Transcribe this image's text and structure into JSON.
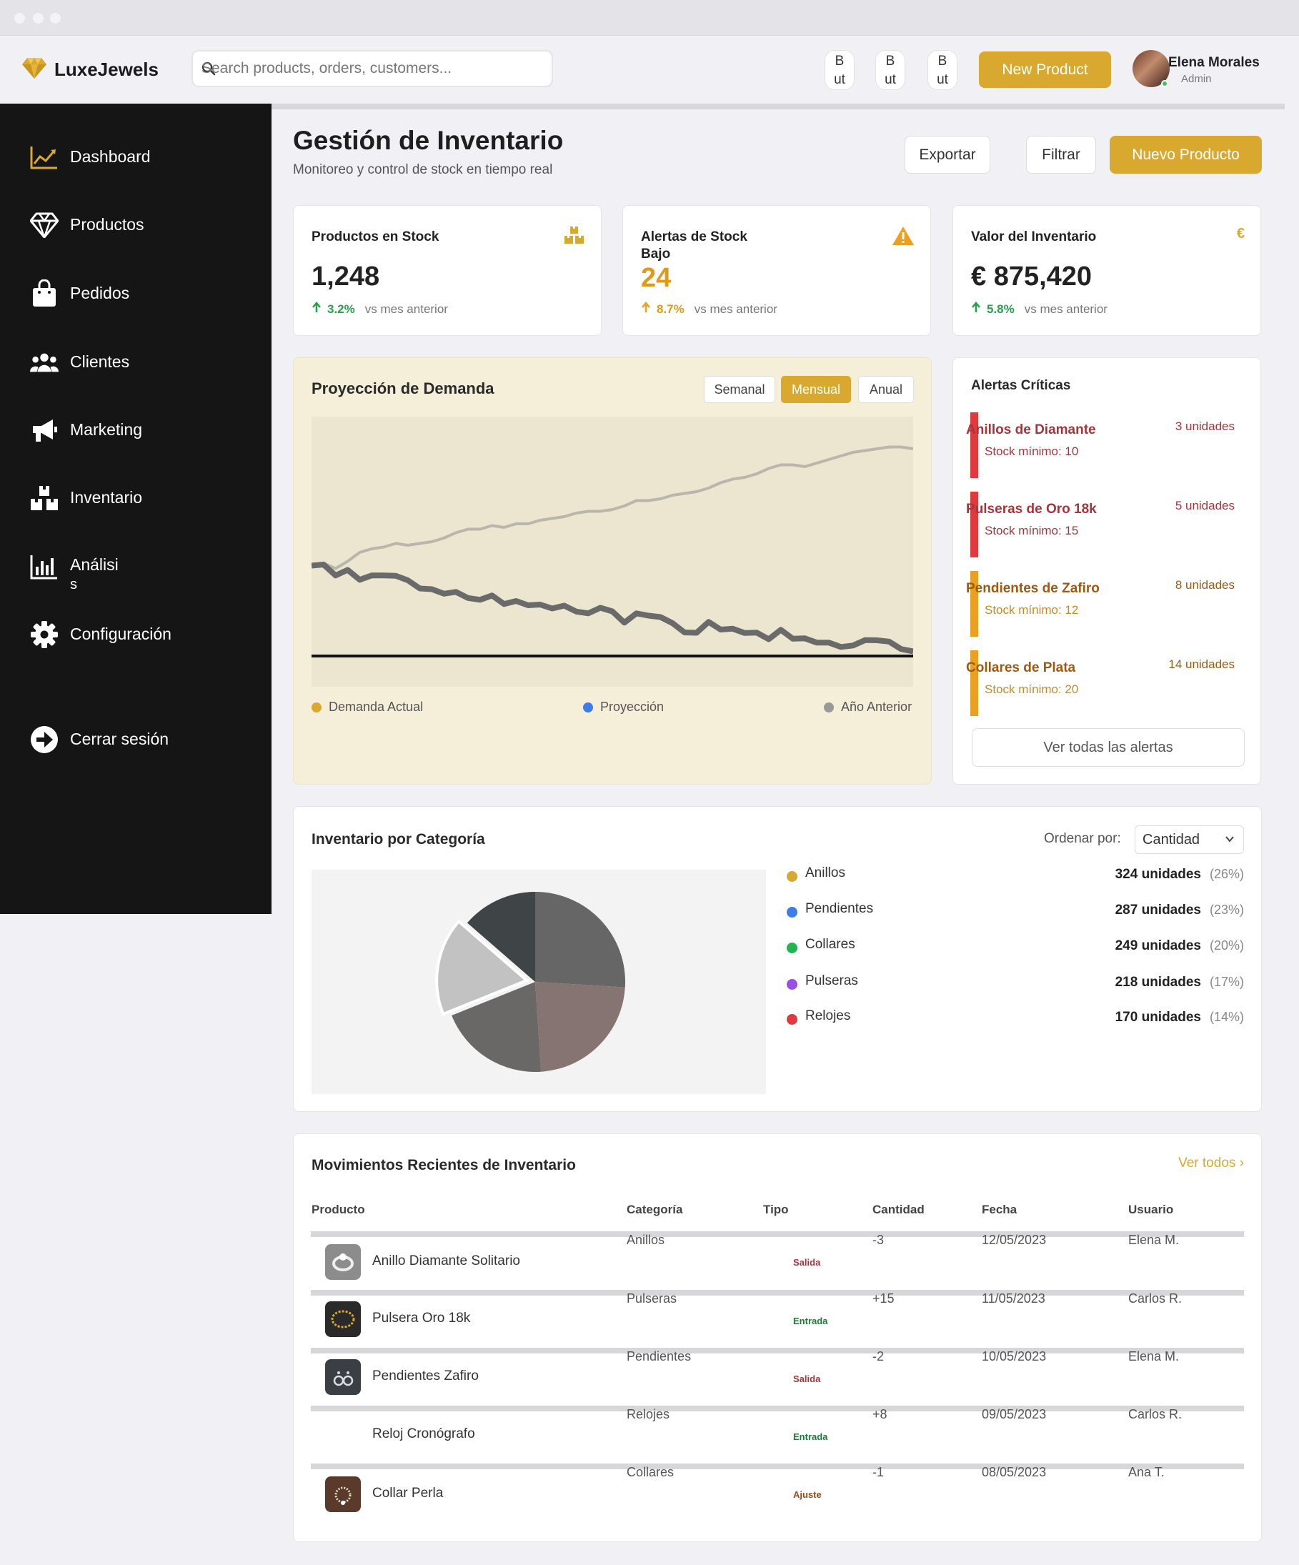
{
  "app": {
    "brand": "LuxeJewels"
  },
  "search": {
    "placeholder": "Search products, orders, customers..."
  },
  "topbar": {
    "mini_buttons": [
      {
        "line1": "B",
        "line2": "ut"
      },
      {
        "line1": "B",
        "line2": "ut"
      },
      {
        "line1": "B",
        "line2": "ut"
      }
    ],
    "new_product": "New Product",
    "user": {
      "name": "Elena Morales",
      "role": "Admin"
    }
  },
  "sidebar": {
    "items": [
      {
        "label": "Dashboard",
        "icon": "chart-line-icon"
      },
      {
        "label": "Productos",
        "icon": "diamond-icon"
      },
      {
        "label": "Pedidos",
        "icon": "shopping-bag-icon"
      },
      {
        "label": "Clientes",
        "icon": "users-icon"
      },
      {
        "label": "Marketing",
        "icon": "megaphone-icon"
      },
      {
        "label": "Inventario",
        "icon": "boxes-icon"
      },
      {
        "label": "Análisi s",
        "line1": "Análisi",
        "line2": "s",
        "icon": "bar-chart-icon"
      },
      {
        "label": "Configuración",
        "icon": "gear-icon"
      }
    ],
    "logout": "Cerrar sesión"
  },
  "header": {
    "title": "Gestión de Inventario",
    "subtitle": "Monitoreo y control de stock en tiempo real",
    "buttons": {
      "export": "Exportar",
      "filter": "Filtrar",
      "new": "Nuevo Producto"
    }
  },
  "stats": [
    {
      "label": "Productos en Stock",
      "value": "1,248",
      "change": "3.2%",
      "compare": "vs mes anterior",
      "icon": "boxes-icon"
    },
    {
      "label": "Alertas de Stock Bajo",
      "label_line1": "Alertas de Stock",
      "label_line2": "Bajo",
      "value": "24",
      "change": "8.7%",
      "compare": "vs mes anterior",
      "icon": "warning-icon"
    },
    {
      "label": "Valor del Inventario",
      "value": "€ 875,420",
      "change": "5.8%",
      "compare": "vs mes anterior",
      "icon": "euro-icon",
      "icon_text": "€"
    }
  ],
  "demand": {
    "title": "Proyección de Demanda",
    "periods": [
      "Semanal",
      "Mensual",
      "Anual"
    ],
    "active_period": "Mensual",
    "legend": [
      {
        "name": "Demanda Actual",
        "color": "#d9a82e"
      },
      {
        "name": "Proyección",
        "color": "#3b7de9"
      },
      {
        "name": "Año Anterior",
        "color": "#999999"
      }
    ],
    "colors": {
      "actual": "#6a6a6a",
      "previous": "#b9b6ae"
    }
  },
  "chart_data": {
    "type": "line",
    "x": [
      0,
      1,
      2,
      3,
      4,
      5,
      6,
      7,
      8,
      9,
      10,
      11,
      12,
      13,
      14,
      15,
      16,
      17,
      18,
      19,
      20,
      21,
      22,
      23,
      24,
      25,
      26,
      27,
      28,
      29,
      30,
      31,
      32,
      33,
      34,
      35,
      36,
      37,
      38,
      39,
      40,
      41,
      42,
      43,
      44,
      45,
      46,
      47,
      48,
      49,
      50
    ],
    "series": [
      {
        "name": "Demanda Actual",
        "values": [
          50.6,
          51.2,
          45.1,
          48.2,
          42.7,
          45.1,
          45.1,
          44.9,
          42.4,
          37.8,
          37.4,
          34.9,
          35.9,
          32.5,
          31.5,
          33.9,
          29.1,
          30.8,
          28.4,
          28.8,
          26.6,
          28.2,
          24.9,
          23.9,
          27.0,
          25.0,
          18.7,
          23.9,
          22.6,
          21.8,
          18.4,
          13.2,
          13.0,
          19.1,
          14.8,
          15.3,
          12.9,
          13.1,
          9.4,
          14.7,
          9.7,
          9.9,
          7.5,
          7.5,
          5.1,
          5.9,
          8.9,
          8.8,
          8.1,
          3.9,
          2.6
        ]
      },
      {
        "name": "Año Anterior",
        "values": [
          51.0,
          52.0,
          49.0,
          53.0,
          58.0,
          60.0,
          61.0,
          63.0,
          62.0,
          63.0,
          64.0,
          66.0,
          69.0,
          71.0,
          71.0,
          73.0,
          72.0,
          74.0,
          74.0,
          76.0,
          77.0,
          78.0,
          80.0,
          81.0,
          81.0,
          82.0,
          84.0,
          87.0,
          87.0,
          88.0,
          90.0,
          91.0,
          92.0,
          94.0,
          97.0,
          99.0,
          100.0,
          102.0,
          105.0,
          107.0,
          107.0,
          106.0,
          108.0,
          110.0,
          112.0,
          114.0,
          115.0,
          116.0,
          117.0,
          117.0,
          116.0
        ]
      }
    ]
  },
  "alerts": {
    "title": "Alertas Críticas",
    "items": [
      {
        "name": "Anillos de Diamante",
        "min": "Stock mínimo: 10",
        "units": "3 unidades",
        "bar": "#e0393e",
        "text": "#a8343a"
      },
      {
        "name": "Pulseras de Oro 18k",
        "min": "Stock mínimo: 15",
        "units": "5 unidades",
        "bar": "#e0393e",
        "text": "#a8343a"
      },
      {
        "name": "Pendientes de Zafiro",
        "min": "Stock mínimo: 12",
        "units": "8 unidades",
        "bar": "#eba020",
        "text": "#9c5a12"
      },
      {
        "name": "Collares de Plata",
        "min": "Stock mínimo: 20",
        "units": "14 unidades",
        "bar": "#eba020",
        "text": "#9c5a12"
      }
    ],
    "see_all": "Ver todas las alertas"
  },
  "category": {
    "title": "Inventario por Categoría",
    "sort_label": "Ordenar por:",
    "sort_value": "Cantidad",
    "items": [
      {
        "name": "Anillos",
        "units": "324 unidades",
        "pct": "(26%)",
        "value": 324,
        "dot": "#d9a82e",
        "slice": "#666666"
      },
      {
        "name": "Pendientes",
        "units": "287 unidades",
        "pct": "(23%)",
        "value": 287,
        "dot": "#3b7de9",
        "slice": "#857471"
      },
      {
        "name": "Collares",
        "units": "249 unidades",
        "pct": "(20%)",
        "value": 249,
        "dot": "#22b554",
        "slice": "#6a6866"
      },
      {
        "name": "Pulseras",
        "units": "218 unidades",
        "pct": "(17%)",
        "value": 218,
        "dot": "#9a4ee8",
        "slice": "#c2c2c2"
      },
      {
        "name": "Relojes",
        "units": "170 unidades",
        "pct": "(14%)",
        "value": 170,
        "dot": "#e0393e",
        "slice": "#3f4547"
      }
    ]
  },
  "movements": {
    "title": "Movimientos Recientes de Inventario",
    "see_all": "Ver todos",
    "columns": [
      "Producto",
      "Categoría",
      "Tipo",
      "Cantidad",
      "Fecha",
      "Usuario"
    ],
    "rows": [
      {
        "product": "Anillo Diamante Solitario",
        "category": "Anillos",
        "type": "Salida",
        "qty": "-3",
        "date": "12/05/2023",
        "user": "Elena M.",
        "type_color": "#a8343a",
        "thumb": "#8c8c8c"
      },
      {
        "product": "Pulsera Oro 18k",
        "category": "Pulseras",
        "type": "Entrada",
        "qty": "+15",
        "date": "11/05/2023",
        "user": "Carlos R.",
        "type_color": "#1f7a3a",
        "thumb": "#2a2a2a"
      },
      {
        "product": "Pendientes Zafiro",
        "category": "Pendientes",
        "type": "Salida",
        "qty": "-2",
        "date": "10/05/2023",
        "user": "Elena M.",
        "type_color": "#a8343a",
        "thumb": "#3a3f46"
      },
      {
        "product": "Reloj Cronógrafo",
        "category": "Relojes",
        "type": "Entrada",
        "qty": "+8",
        "date": "09/05/2023",
        "user": "Carlos R.",
        "type_color": "#1f7a3a",
        "thumb": ""
      },
      {
        "product": "Collar Perla",
        "category": "Collares",
        "type": "Ajuste",
        "qty": "-1",
        "date": "08/05/2023",
        "user": "Ana T.",
        "type_color": "#9c4a12",
        "thumb": "#5a3a2a"
      }
    ]
  }
}
